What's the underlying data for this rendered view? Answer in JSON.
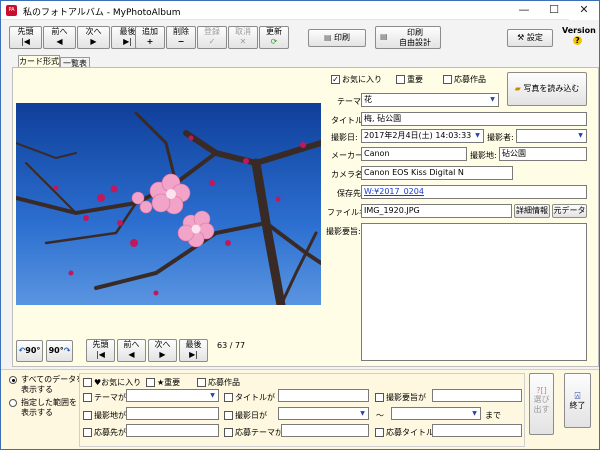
{
  "window": {
    "title": "私のフォトアルバム - MyPhotoAlbum",
    "min": "—",
    "max": "☐",
    "close": "✕"
  },
  "toolbar": {
    "first": "先頭",
    "prev": "前へ",
    "next": "次へ",
    "last": "最後",
    "add": "追加",
    "delete": "削除",
    "register": "登録",
    "cancel": "取消",
    "update": "更新",
    "print": "印刷",
    "print_free": "印刷\n自由設計",
    "settings": "設定",
    "version": "Version"
  },
  "tabs": [
    "カード形式",
    "一覧表"
  ],
  "checks": {
    "favorite": "お気に入り",
    "favorite_checked": true,
    "important": "重要",
    "contest": "応募作品"
  },
  "load_photo": "写真を読み込む",
  "fields": {
    "theme_label": "テーマ:",
    "theme": "花",
    "title_label": "タイトル:",
    "title": "梅, 砧公園",
    "date_label": "撮影日:",
    "date": "2017年2月4日(土) 14:03:33",
    "photographer_label": "撮影者:",
    "photographer": "",
    "maker_label": "メーカー:",
    "maker": "Canon",
    "place_label": "撮影地:",
    "place": "砧公園",
    "camera_label": "カメラ名:",
    "camera": "Canon EOS Kiss Digital N",
    "folder_label": "保存先:",
    "folder": "W:¥2017_0204",
    "file_label": "ファイル名:",
    "file": "IMG_1920.JPG",
    "detail_btn": "詳細情報",
    "meta_btn": "元データ",
    "notes_label": "撮影要旨:"
  },
  "rotate": {
    "left": "90°",
    "right": "90°"
  },
  "nav": {
    "first": "先頭",
    "prev": "前へ",
    "next": "次へ",
    "last": "最後",
    "count": "63 / 77"
  },
  "filter": {
    "show_all": "すべてのデータを\n表示する",
    "show_range": "指定した範囲を\n表示する",
    "fav": "♥お気に入り",
    "imp": "★重要",
    "contest": "応募作品",
    "theme": "テーマが",
    "title": "タイトルが",
    "notes": "撮影要旨が",
    "place": "撮影地が",
    "date": "撮影日が",
    "tilde": "〜",
    "until": "まで",
    "dest": "応募先が",
    "dest_theme": "応募テーマが",
    "dest_title": "応募タイトルが",
    "select_btn": "選び\n出す",
    "exit_btn": "終了"
  }
}
